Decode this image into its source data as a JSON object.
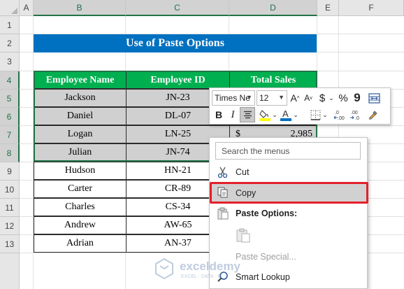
{
  "grid": {
    "columns": [
      "A",
      "B",
      "C",
      "D",
      "E",
      "F"
    ],
    "rows": [
      "1",
      "2",
      "3",
      "4",
      "5",
      "6",
      "7",
      "8",
      "9",
      "10",
      "11",
      "12",
      "13"
    ]
  },
  "title": "Use of Paste Options",
  "table": {
    "headers": [
      "Employee Name",
      "Employee ID",
      "Total Sales"
    ],
    "rows": [
      {
        "name": "Jackson",
        "id": "JN-23"
      },
      {
        "name": "Daniel",
        "id": "DL-07"
      },
      {
        "name": "Logan",
        "id": "LN-25",
        "sales_symbol": "$",
        "sales": "2,985"
      },
      {
        "name": "Julian",
        "id": "JN-74"
      },
      {
        "name": "Hudson",
        "id": "HN-21"
      },
      {
        "name": "Carter",
        "id": "CR-89"
      },
      {
        "name": "Charles",
        "id": "CS-34"
      },
      {
        "name": "Andrew",
        "id": "AW-65"
      },
      {
        "name": "Adrian",
        "id": "AN-37"
      }
    ]
  },
  "mini_toolbar": {
    "font_name": "Times Ne",
    "font_size": "12",
    "bold": "B",
    "italic": "I",
    "currency": "$",
    "percent": "%",
    "comma": "9"
  },
  "context_menu": {
    "search_placeholder": "Search the menus",
    "cut": "Cut",
    "copy": "Copy",
    "paste_options": "Paste Options:",
    "paste_special": "Paste Special...",
    "smart_lookup": "Smart Lookup"
  },
  "watermark": {
    "name": "exceldemy",
    "tagline": "EXCEL · DATA · BI"
  },
  "colors": {
    "title_bg": "#0070c0",
    "header_bg": "#00b050",
    "selection": "#217346",
    "highlight_border": "#e3202a"
  }
}
